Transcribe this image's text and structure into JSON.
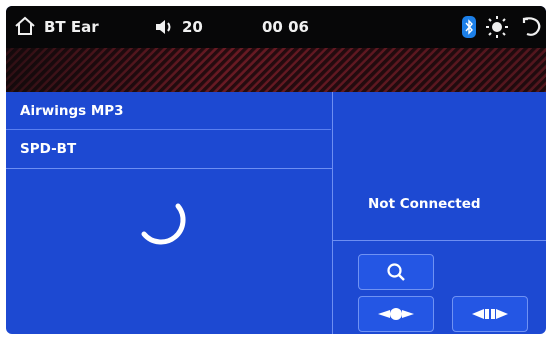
{
  "topbar": {
    "source_label": "BT Ear",
    "volume": "20",
    "time": "00 06",
    "icons": [
      "home-icon",
      "volume-icon",
      "bluetooth-icon",
      "brightness-icon",
      "back-icon"
    ]
  },
  "devices": [
    {
      "name": "Airwings MP3"
    },
    {
      "name": "SPD-BT"
    }
  ],
  "status": "Not Connected",
  "buttons": [
    "search-icon",
    "connect-icon",
    "disconnect-icon"
  ],
  "colors": {
    "panel": "#1d49d2",
    "topbar": "#070708",
    "accent": "#1c7fe8"
  }
}
